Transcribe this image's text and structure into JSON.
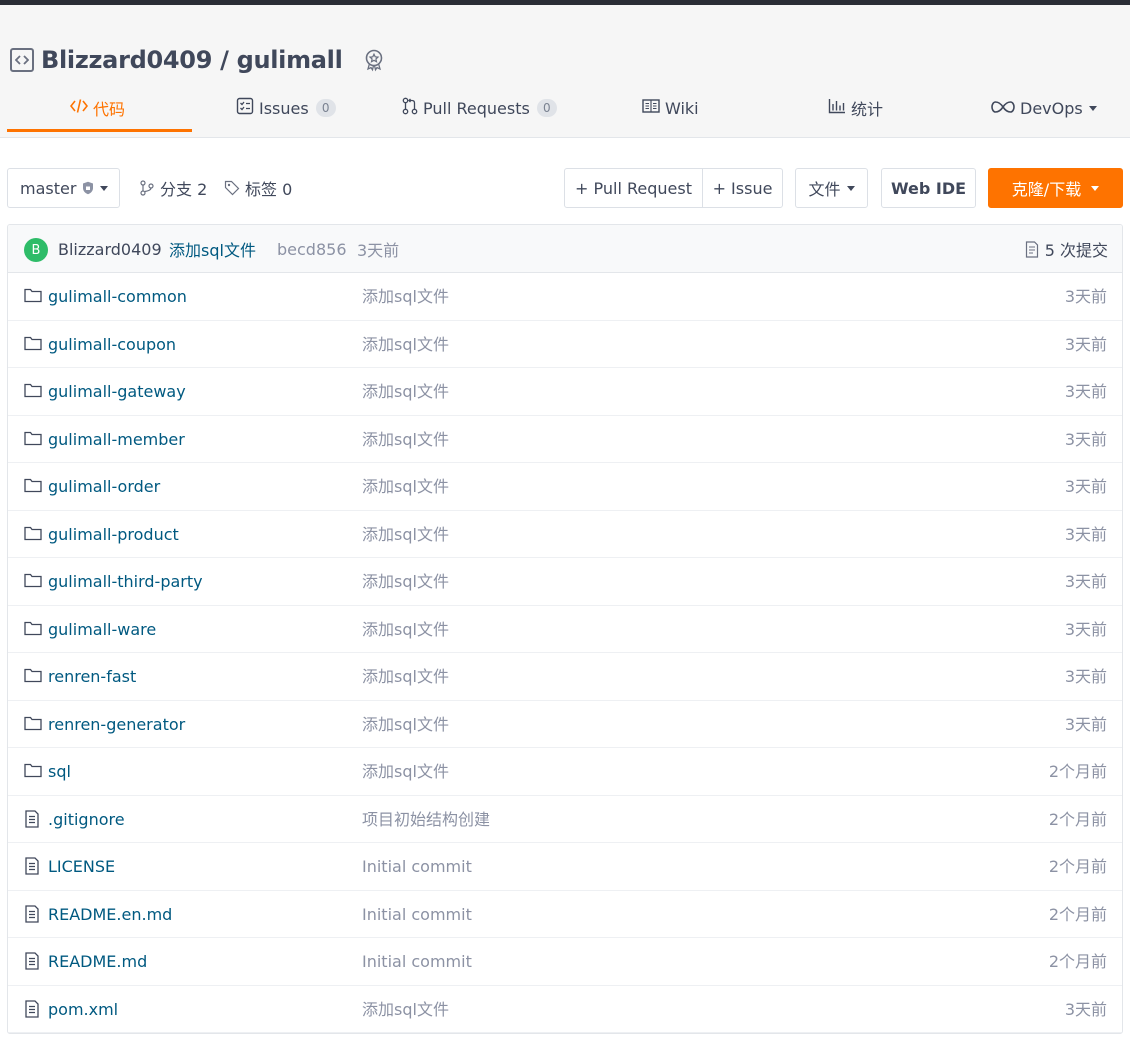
{
  "repo": {
    "owner": "Blizzard0409",
    "separator": "/",
    "name": "gulimall"
  },
  "tabs": [
    {
      "label": "代码",
      "icon": "code-icon",
      "active": true
    },
    {
      "label": "Issues",
      "count": "0",
      "icon": "issues-icon"
    },
    {
      "label": "Pull Requests",
      "count": "0",
      "icon": "pull-request-icon"
    },
    {
      "label": "Wiki",
      "icon": "wiki-icon"
    },
    {
      "label": "统计",
      "icon": "stats-icon"
    },
    {
      "label": "DevOps",
      "icon": "devops-icon"
    }
  ],
  "toolbar": {
    "branch": "master",
    "branches_label": "分支 2",
    "tags_label": "标签 0",
    "pull_request": "+ Pull Request",
    "issue": "+ Issue",
    "file": "文件",
    "web_ide": "Web IDE",
    "clone": "克隆/下载"
  },
  "colors": {
    "accent": "#fe7300",
    "link": "#005980",
    "avatar": "#2ebc68"
  },
  "commit": {
    "avatar_letter": "B",
    "author": "Blizzard0409",
    "message": "添加sql文件",
    "hash": "becd856",
    "time": "3天前",
    "count_label": "5 次提交"
  },
  "files": [
    {
      "name": "gulimall-common",
      "type": "folder",
      "message": "添加sql文件",
      "time": "3天前"
    },
    {
      "name": "gulimall-coupon",
      "type": "folder",
      "message": "添加sql文件",
      "time": "3天前"
    },
    {
      "name": "gulimall-gateway",
      "type": "folder",
      "message": "添加sql文件",
      "time": "3天前"
    },
    {
      "name": "gulimall-member",
      "type": "folder",
      "message": "添加sql文件",
      "time": "3天前"
    },
    {
      "name": "gulimall-order",
      "type": "folder",
      "message": "添加sql文件",
      "time": "3天前"
    },
    {
      "name": "gulimall-product",
      "type": "folder",
      "message": "添加sql文件",
      "time": "3天前"
    },
    {
      "name": "gulimall-third-party",
      "type": "folder",
      "message": "添加sql文件",
      "time": "3天前"
    },
    {
      "name": "gulimall-ware",
      "type": "folder",
      "message": "添加sql文件",
      "time": "3天前"
    },
    {
      "name": "renren-fast",
      "type": "folder",
      "message": "添加sql文件",
      "time": "3天前"
    },
    {
      "name": "renren-generator",
      "type": "folder",
      "message": "添加sql文件",
      "time": "3天前"
    },
    {
      "name": "sql",
      "type": "folder",
      "message": "添加sql文件",
      "time": "2个月前"
    },
    {
      "name": ".gitignore",
      "type": "file",
      "message": "项目初始结构创建",
      "time": "2个月前"
    },
    {
      "name": "LICENSE",
      "type": "file",
      "message": "Initial commit",
      "time": "2个月前"
    },
    {
      "name": "README.en.md",
      "type": "file",
      "message": "Initial commit",
      "time": "2个月前"
    },
    {
      "name": "README.md",
      "type": "file",
      "message": "Initial commit",
      "time": "2个月前"
    },
    {
      "name": "pom.xml",
      "type": "file",
      "message": "添加sql文件",
      "time": "3天前"
    }
  ]
}
